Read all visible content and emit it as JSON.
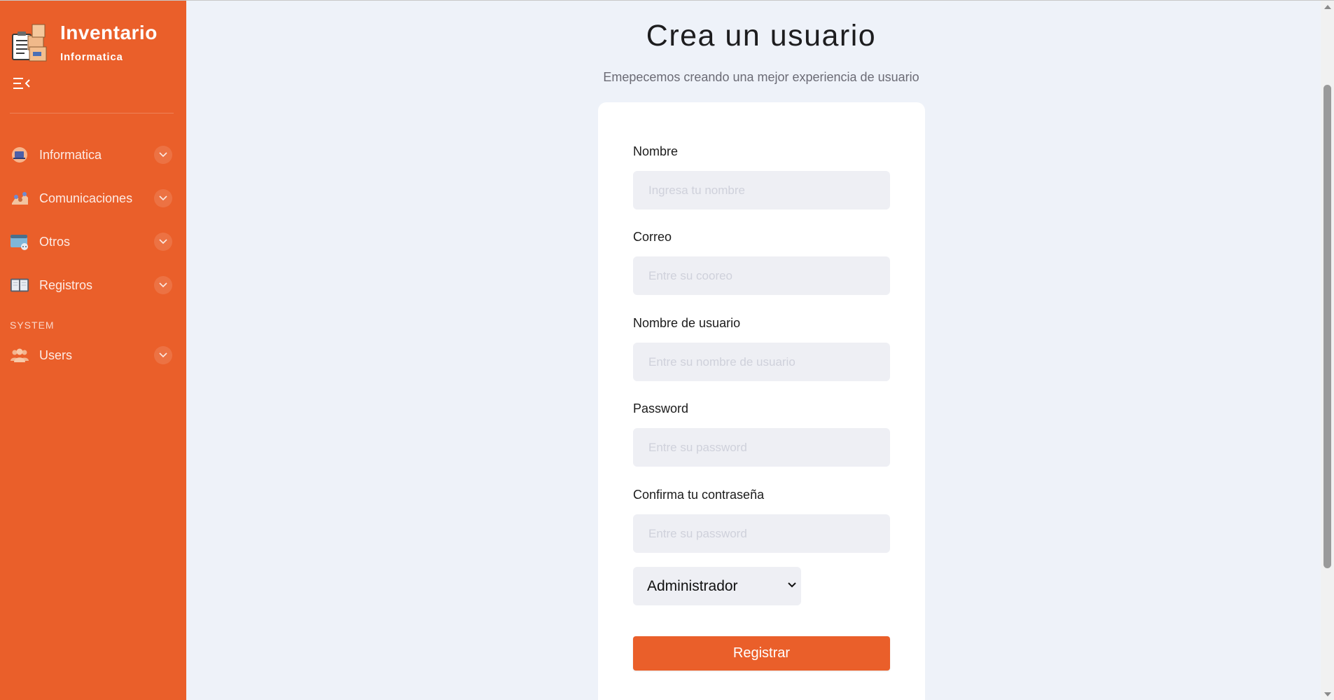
{
  "sidebar": {
    "brand_title": "Inventario",
    "brand_subtitle": "Informatica",
    "items": [
      {
        "label": "Informatica",
        "icon": "laptop-icon"
      },
      {
        "label": "Comunicaciones",
        "icon": "network-hands-icon"
      },
      {
        "label": "Otros",
        "icon": "browser-window-icon"
      },
      {
        "label": "Registros",
        "icon": "open-book-icon"
      }
    ],
    "section_label": "SYSTEM",
    "system_items": [
      {
        "label": "Users",
        "icon": "users-icon"
      }
    ]
  },
  "main": {
    "title": "Crea un usuario",
    "subtitle": "Emepecemos creando una mejor experiencia de usuario"
  },
  "form": {
    "nombre": {
      "label": "Nombre",
      "placeholder": "Ingresa tu nombre",
      "value": ""
    },
    "correo": {
      "label": "Correo",
      "placeholder": "Entre su cooreo",
      "value": ""
    },
    "usuario": {
      "label": "Nombre de usuario",
      "placeholder": "Entre su nombre de usuario",
      "value": ""
    },
    "password": {
      "label": "Password",
      "placeholder": "Entre su password",
      "value": ""
    },
    "confirm": {
      "label": "Confirma tu contraseña",
      "placeholder": "Entre su password",
      "value": ""
    },
    "role_selected": "Administrador",
    "submit_label": "Registrar"
  },
  "colors": {
    "accent": "#ea5f2a",
    "background": "#eef2f9",
    "input_bg": "#eeeff4"
  }
}
